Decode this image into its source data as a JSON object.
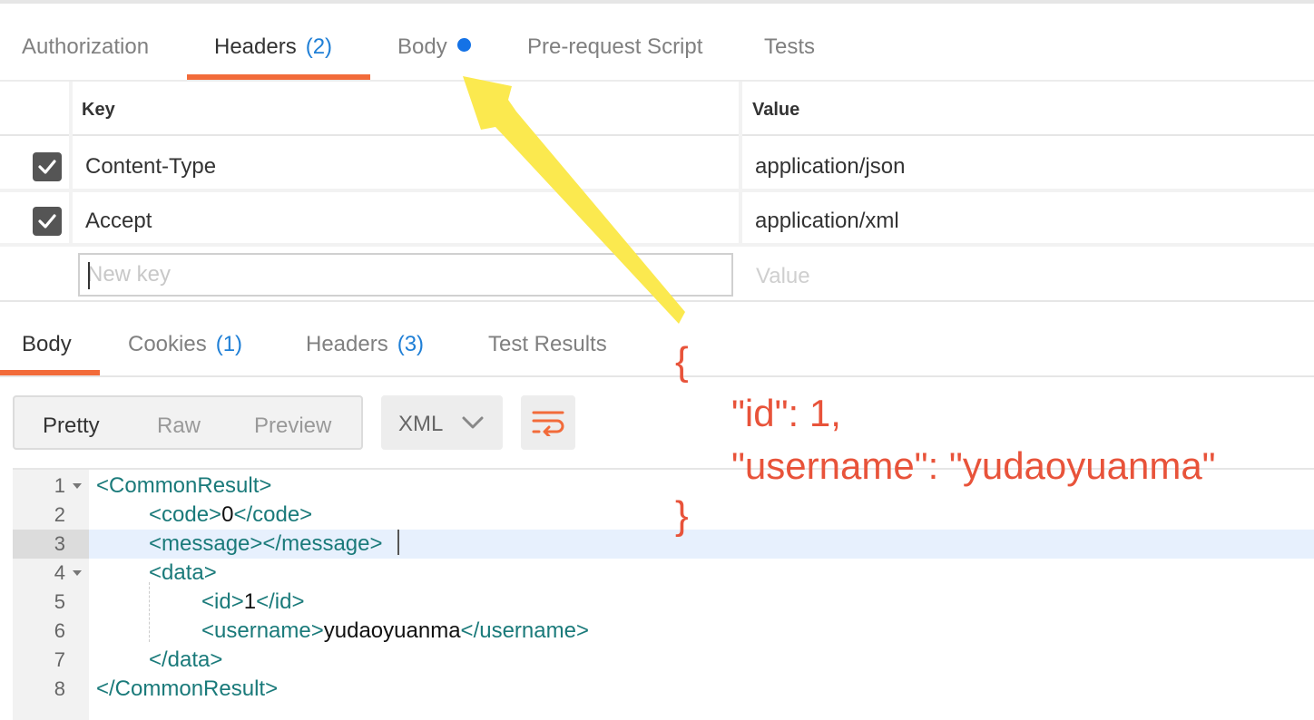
{
  "request_tabs": [
    {
      "label": "Authorization",
      "count": ""
    },
    {
      "label": "Headers",
      "count": "(2)"
    },
    {
      "label": "Body",
      "count": ""
    },
    {
      "label": "Pre-request Script",
      "count": ""
    },
    {
      "label": "Tests",
      "count": ""
    }
  ],
  "headers_table": {
    "columns": {
      "key": "Key",
      "value": "Value"
    },
    "rows": [
      {
        "checked": true,
        "key": "Content-Type",
        "value": "application/json"
      },
      {
        "checked": true,
        "key": "Accept",
        "value": "application/xml"
      }
    ],
    "new_row": {
      "key_placeholder": "New key",
      "value_placeholder": "Value"
    }
  },
  "response_tabs": [
    {
      "label": "Body",
      "count": ""
    },
    {
      "label": "Cookies",
      "count": "(1)"
    },
    {
      "label": "Headers",
      "count": "(3)"
    },
    {
      "label": "Test Results",
      "count": ""
    }
  ],
  "view_modes": [
    "Pretty",
    "Raw",
    "Preview"
  ],
  "format": "XML",
  "code_lines": [
    {
      "n": "1",
      "fold": true
    },
    {
      "n": "2",
      "fold": false
    },
    {
      "n": "3",
      "fold": false
    },
    {
      "n": "4",
      "fold": true
    },
    {
      "n": "5",
      "fold": false
    },
    {
      "n": "6",
      "fold": false
    },
    {
      "n": "7",
      "fold": false
    },
    {
      "n": "8",
      "fold": false
    }
  ],
  "code": {
    "l1_open": "<CommonResult>",
    "l2_open": "<code>",
    "l2_val": "0",
    "l2_close": "</code>",
    "l3": "<message></message>",
    "l4": "<data>",
    "l5_open": "<id>",
    "l5_val": "1",
    "l5_close": "</id>",
    "l6_open": "<username>",
    "l6_val": "yudaoyuanma",
    "l6_close": "</username>",
    "l7": "</data>",
    "l8": "</CommonResult>"
  },
  "annotation": {
    "open": "{",
    "line1": "\"id\": 1,",
    "line2": "\"username\": \"yudaoyuanma\"",
    "close": "}"
  },
  "colors": {
    "accent": "#f26b3a",
    "count": "#1f7fd6",
    "dot": "#1472e6",
    "annotation": "#e8533a",
    "arrow": "#fbe94f"
  }
}
